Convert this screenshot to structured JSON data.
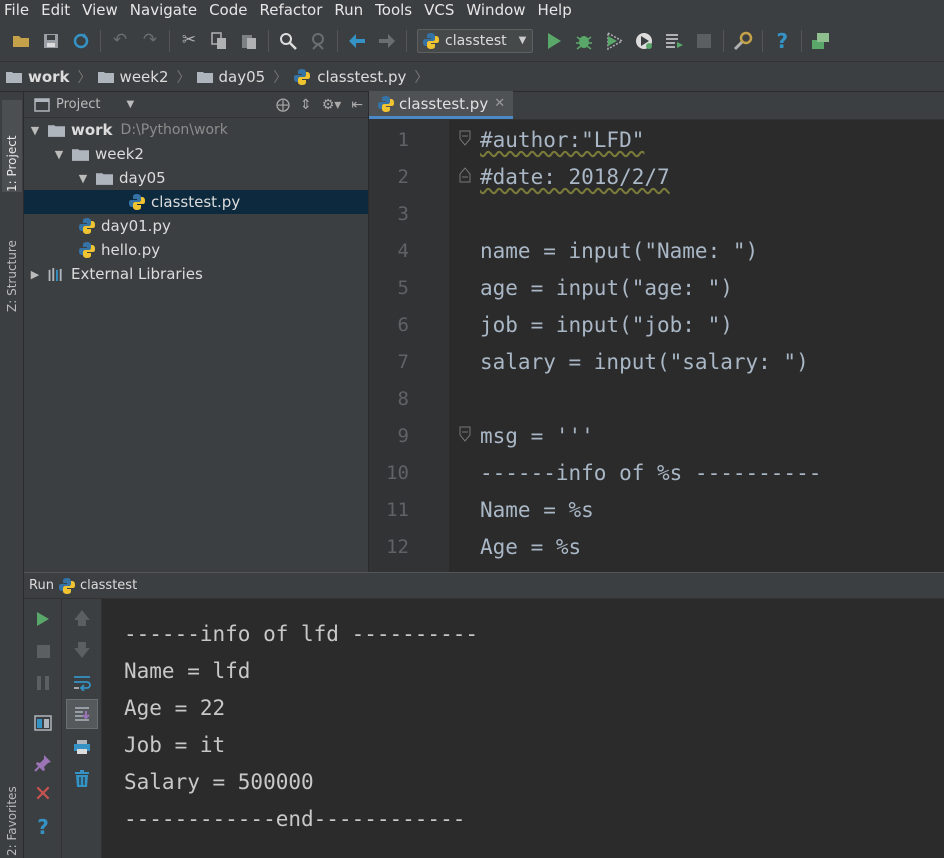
{
  "menu": [
    "File",
    "Edit",
    "View",
    "Navigate",
    "Code",
    "Refactor",
    "Run",
    "Tools",
    "VCS",
    "Window",
    "Help"
  ],
  "toolbar": {
    "run_config": "classtest",
    "icons": [
      "open-icon",
      "save-icon",
      "sync-icon",
      "undo-icon",
      "redo-icon",
      "cut-icon",
      "copy-icon",
      "paste-icon",
      "find-icon",
      "replace-icon",
      "back-icon",
      "forward-icon",
      "run-icon",
      "debug-icon",
      "coverage-icon",
      "profile-icon",
      "build-icon",
      "stop-icon",
      "settings-icon",
      "help-icon",
      "sdk-icon"
    ]
  },
  "breadcrumb": [
    "work",
    "week2",
    "day05",
    "classtest.py"
  ],
  "left_strip": {
    "project_tab": "1: Project",
    "structure_tab": "Z: Structure",
    "favorites_tab": "2: Favorites"
  },
  "project_panel": {
    "title": "Project",
    "tree": [
      {
        "label": "work",
        "path": "D:\\Python\\work",
        "kind": "folder",
        "expanded": true,
        "depth": 0
      },
      {
        "label": "week2",
        "kind": "folder",
        "expanded": true,
        "depth": 1
      },
      {
        "label": "day05",
        "kind": "folder",
        "expanded": true,
        "depth": 2
      },
      {
        "label": "classtest.py",
        "kind": "python",
        "depth": 3,
        "selected": true
      },
      {
        "label": "day01.py",
        "kind": "python",
        "depth": 1
      },
      {
        "label": "hello.py",
        "kind": "python",
        "depth": 1
      },
      {
        "label": "External Libraries",
        "kind": "library",
        "depth": 0
      }
    ]
  },
  "editor": {
    "tab_label": "classtest.py",
    "lines": [
      {
        "n": "1",
        "text": "#author:\"LFD\""
      },
      {
        "n": "2",
        "text": "#date: 2018/2/7"
      },
      {
        "n": "3",
        "text": ""
      },
      {
        "n": "4",
        "text": "name = input(\"Name: \")"
      },
      {
        "n": "5",
        "text": "age = input(\"age: \")"
      },
      {
        "n": "6",
        "text": "job = input(\"job: \")"
      },
      {
        "n": "7",
        "text": "salary = input(\"salary: \")"
      },
      {
        "n": "8",
        "text": ""
      },
      {
        "n": "9",
        "text": "msg = '''"
      },
      {
        "n": "10",
        "text": "------info of %s ----------"
      },
      {
        "n": "11",
        "text": "Name = %s"
      },
      {
        "n": "12",
        "text": "Age = %s"
      }
    ]
  },
  "run_panel": {
    "label": "Run",
    "config": "classtest",
    "output": [
      "------info of lfd ----------",
      "Name = lfd",
      "Age = 22",
      "Job = it",
      "Salary = 500000",
      "------------end------------"
    ]
  },
  "colors": {
    "run_green": "#59a869",
    "stop_red": "#c75450",
    "help_blue": "#3592c4",
    "python_blue": "#3572a5",
    "python_yellow": "#f0c330"
  }
}
